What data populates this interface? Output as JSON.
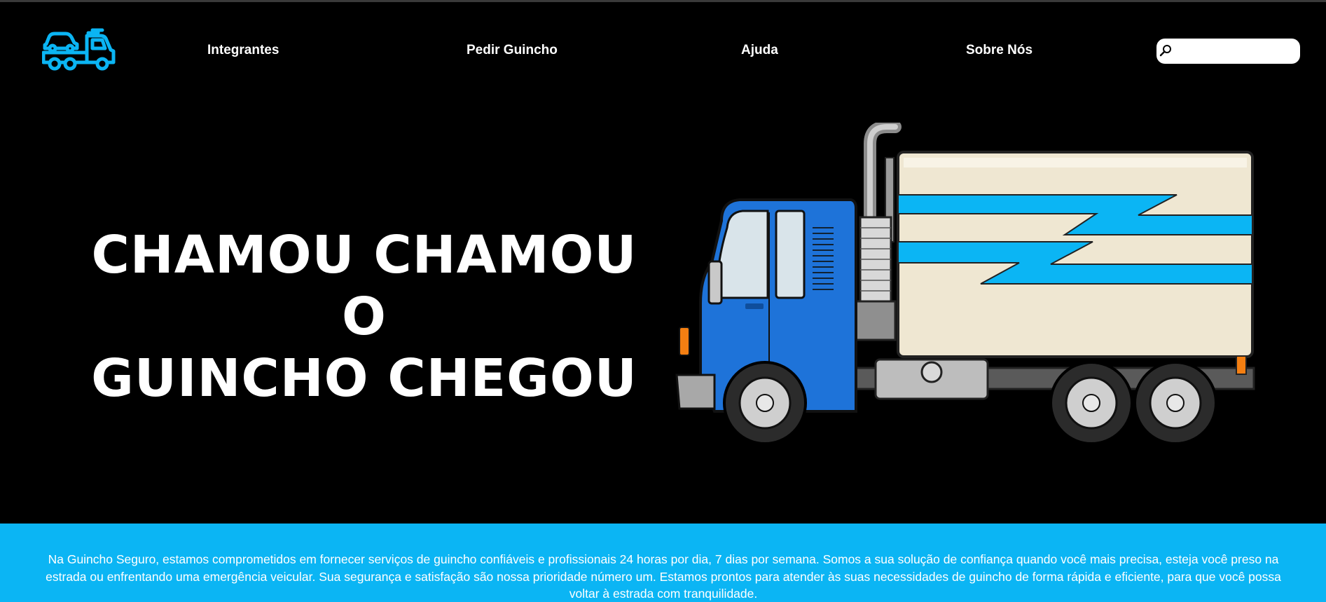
{
  "brand": {
    "logo_icon": "tow-truck-icon",
    "accent_color": "#0bb5f4"
  },
  "nav": {
    "items": [
      {
        "label": "Integrantes"
      },
      {
        "label": "Pedir Guincho"
      },
      {
        "label": "Ajuda"
      },
      {
        "label": "Sobre Nós"
      }
    ]
  },
  "search": {
    "icon": "search-icon",
    "value": "",
    "placeholder": ""
  },
  "hero": {
    "title_line1": "CHAMOU CHAMOU O",
    "title_line2": "GUINCHO CHEGOU",
    "image_icon": "truck-illustration"
  },
  "about": {
    "text": "Na Guincho Seguro, estamos comprometidos em fornecer serviços de guincho confiáveis e profissionais 24 horas por dia, 7 dias por semana. Somos a sua solução de confiança quando você mais precisa, esteja você preso na estrada ou enfrentando uma emergência veicular. Sua segurança e satisfação são nossa prioridade número um. Estamos prontos para atender às suas necessidades de guincho de forma rápida e eficiente, para que você possa voltar à estrada com tranquilidade."
  }
}
